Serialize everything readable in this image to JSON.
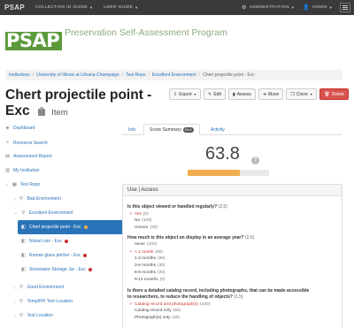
{
  "topnav": {
    "brand": "PSAP",
    "left_items": [
      "COLLECTION ID GUIDE",
      "USER GUIDE"
    ],
    "right_items": [
      "ADMINISTRATION",
      "ADMIN"
    ]
  },
  "header": {
    "logo_text": "PSAP",
    "program_title": "Preservation Self-Assessment Program"
  },
  "breadcrumb": [
    "Institutions",
    "University of Illinois at Urbana-Champaign",
    "Test Repo",
    "Excellent Environment",
    "Chert projectile point - Exc"
  ],
  "title": {
    "text": "Chert projectile point - Exc",
    "kind": "Item"
  },
  "actions": {
    "export": "Export",
    "edit": "Edit",
    "assess": "Assess",
    "move": "Move",
    "clone": "Clone",
    "delete": "Delete"
  },
  "sidebar": {
    "dashboard": "Dashboard",
    "resource_search": "Resource Search",
    "assessment_report": "Assessment Report",
    "my_institution": "My Institution",
    "test_repo": "Test Repo",
    "bad_environment": "Bad Environment",
    "excellent_environment": "Excellent Environment",
    "chert": "Chert projectile point - Exc",
    "nickel": "Nickel coin - Exc",
    "roman": "Roman glass pitcher - Exc",
    "stoneware": "Stoneware Storage Jar - Exc",
    "good_environment": "Good Environment",
    "temp_rh": "Temp/RH Test Location",
    "test_location": "Test Location"
  },
  "tabs": {
    "info": "Info",
    "score_summary": "Score Summary",
    "score_badge": "63.8",
    "activity": "Activity"
  },
  "score": {
    "value": "63.8",
    "percent": 63.8,
    "help_icon_label": "?"
  },
  "section": {
    "title": "Use | Access",
    "q1": {
      "text": "Is this object viewed or handled regularly?",
      "weight": "(2.5)"
    },
    "q1_opts": [
      {
        "label": "Yes",
        "weight": "(0)"
      },
      {
        "label": "No",
        "weight": "(100)"
      },
      {
        "label": "Unsure",
        "weight": "(40)"
      }
    ],
    "q2": {
      "text": "How much is this object on display in an average year?",
      "weight": "(2.0)"
    },
    "q2_opts": [
      {
        "label": "never",
        "weight": "(100)"
      },
      {
        "label": "< 1 month",
        "weight": "(80)"
      },
      {
        "label": "1-2 months",
        "weight": "(60)"
      },
      {
        "label": "3-6 months",
        "weight": "(30)"
      },
      {
        "label": "6-9 months",
        "weight": "(20)"
      },
      {
        "label": "9-12 months",
        "weight": "(0)"
      }
    ],
    "q3": {
      "text": "Is there a detailed catalog record, including photographs, that can be made accessible",
      "text2": "to researchers, to reduce the handling of objects?",
      "weight": "(1.5)"
    },
    "q3_opts": [
      {
        "label": "Catalog record and photograph(s)",
        "weight": "(100)"
      },
      {
        "label": "Catalog record only",
        "weight": "(50)"
      },
      {
        "label": "Photograph(s) only",
        "weight": "(40)"
      }
    ]
  },
  "colors": {
    "nav_bg": "#3a3a3a",
    "link": "#2a73b8",
    "brand_green": "#5b9a3b",
    "danger": "#d9534f",
    "warning": "#f0ad4e"
  }
}
